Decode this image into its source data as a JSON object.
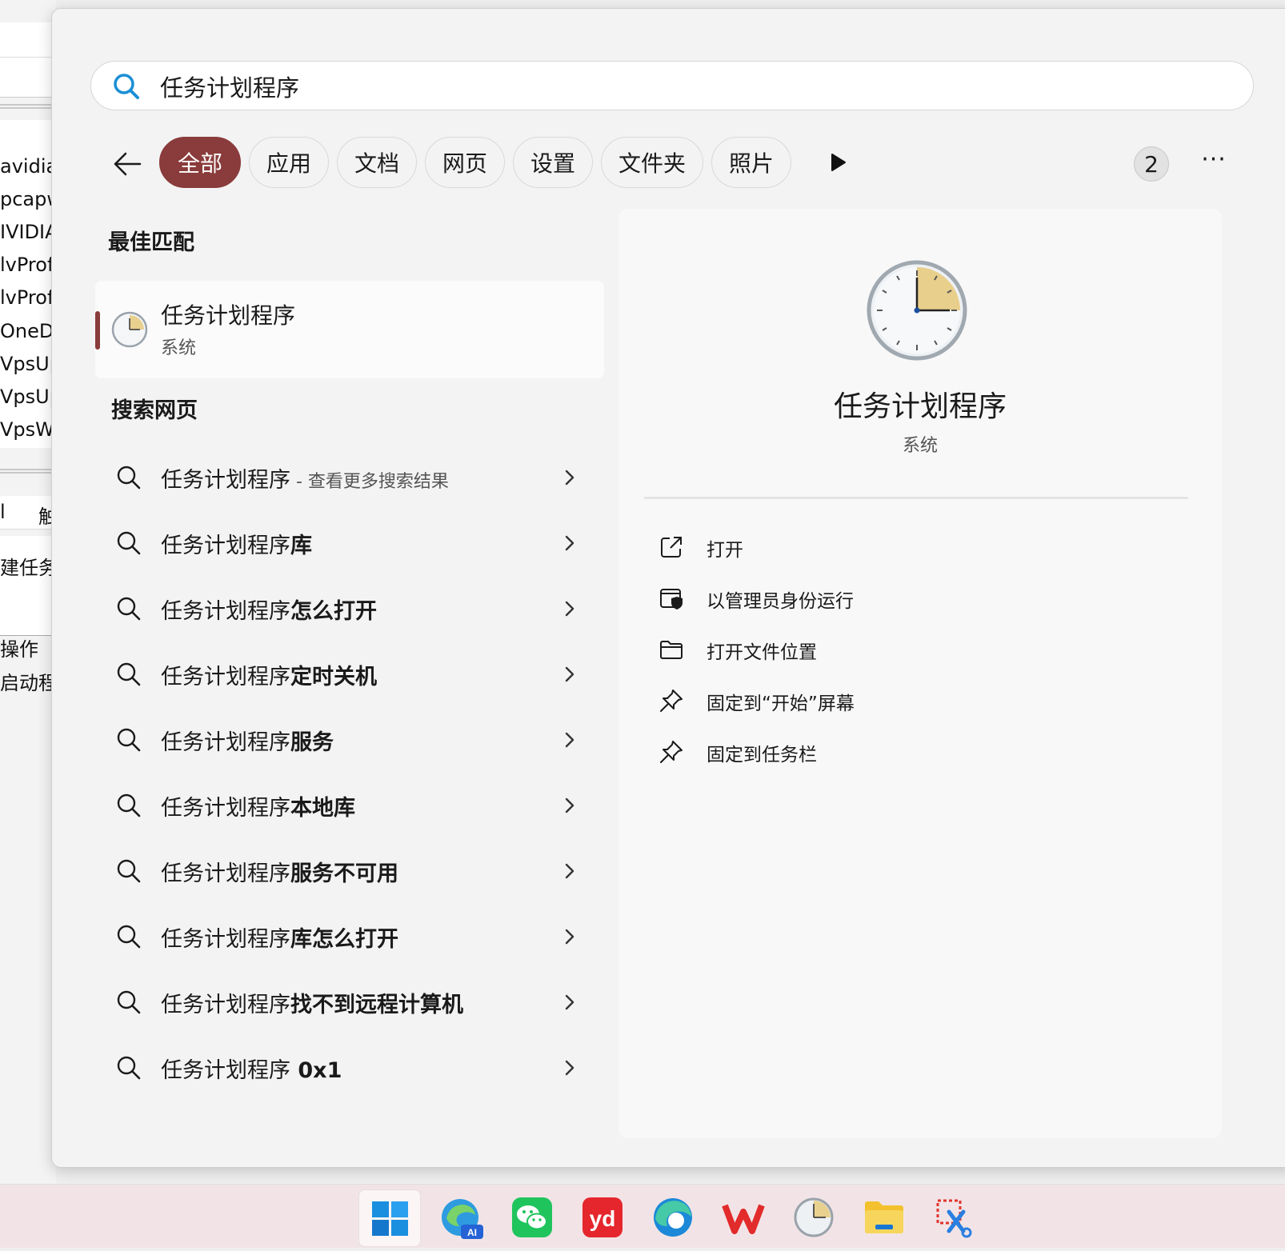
{
  "background_window": {
    "rows": [
      "avidia",
      "pcapw",
      "IVIDIA",
      "lvProfi",
      "lvProfi",
      "OneDri",
      "VpsUp",
      "VpsUp",
      "VpsWa"
    ],
    "header_left": "l",
    "header_right": "触",
    "new_task": "建任务",
    "ops": "操作",
    "launch": "启动程序"
  },
  "search": {
    "query": "任务计划程序",
    "icon": "search-icon"
  },
  "filters": {
    "chips": [
      "全部",
      "应用",
      "文档",
      "网页",
      "设置",
      "文件夹",
      "照片"
    ],
    "active_index": 0,
    "badge": "2",
    "more": "···"
  },
  "best_match": {
    "section_title": "最佳匹配",
    "title": "任务计划程序",
    "subtitle": "系统"
  },
  "web_search": {
    "section_title": "搜索网页",
    "items": [
      {
        "prefix": "任务计划程序",
        "suffix": "",
        "more": " - 查看更多搜索结果"
      },
      {
        "prefix": "任务计划程序",
        "suffix": "库",
        "more": ""
      },
      {
        "prefix": "任务计划程序",
        "suffix": "怎么打开",
        "more": ""
      },
      {
        "prefix": "任务计划程序",
        "suffix": "定时关机",
        "more": ""
      },
      {
        "prefix": "任务计划程序",
        "suffix": "服务",
        "more": ""
      },
      {
        "prefix": "任务计划程序",
        "suffix": "本地库",
        "more": ""
      },
      {
        "prefix": "任务计划程序",
        "suffix": "服务不可用",
        "more": ""
      },
      {
        "prefix": "任务计划程序",
        "suffix": "库怎么打开",
        "more": ""
      },
      {
        "prefix": "任务计划程序",
        "suffix": "找不到远程计算机",
        "more": ""
      },
      {
        "prefix": "任务计划程序",
        "suffix": " 0x1",
        "more": ""
      }
    ]
  },
  "detail": {
    "name": "任务计划程序",
    "type": "系统",
    "actions": [
      "打开",
      "以管理员身份运行",
      "打开文件位置",
      "固定到“开始”屏幕",
      "固定到任务栏"
    ]
  },
  "taskbar": {
    "apps": [
      "start-icon",
      "edge-ai-icon",
      "wechat-icon",
      "youdao-icon",
      "edge-icon",
      "wps-icon",
      "task-scheduler-icon",
      "file-explorer-icon",
      "snipping-tool-icon"
    ],
    "youdao_label": "yd",
    "ai_label": "AI"
  },
  "colors": {
    "accent": "#8a3b3b",
    "taskbar_bg": "#f2e4e6"
  }
}
